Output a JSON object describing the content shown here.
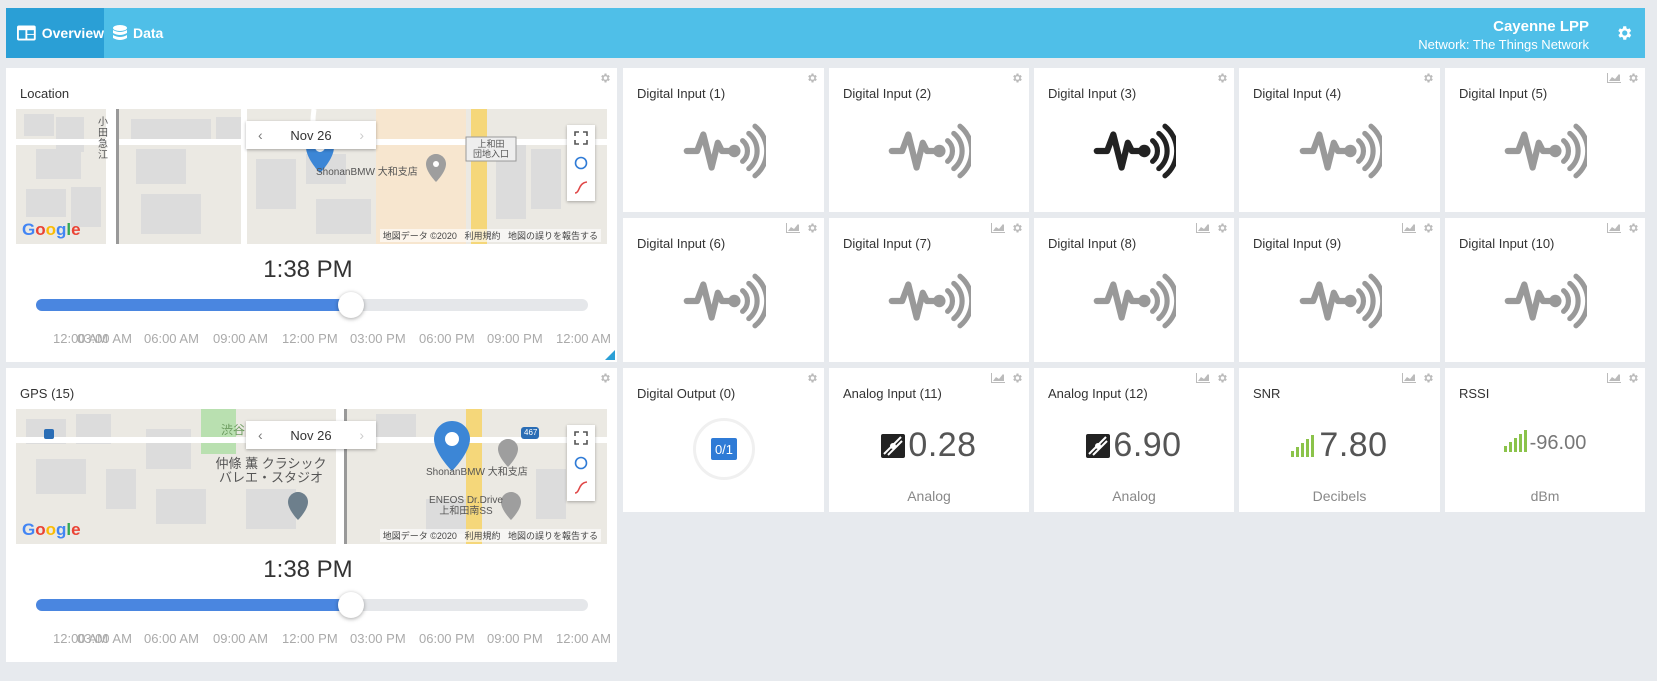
{
  "nav": {
    "tabs": [
      {
        "label": "Overview",
        "icon": "dashboard-icon",
        "active": true
      },
      {
        "label": "Data",
        "icon": "database-icon",
        "active": false
      }
    ],
    "brand_title": "Cayenne LPP",
    "brand_subtitle": "Network: The Things Network"
  },
  "maps": [
    {
      "title": "Location",
      "date": "Nov 26",
      "time": "1:38 PM",
      "slider_fraction": 0.57,
      "labels": [
        "地図データ ©2020",
        "利用規約",
        "地図の誤りを報告する"
      ],
      "places": [
        "ShonanBMW 大和支店",
        "上和田\n団地入口",
        "小田急江"
      ],
      "ticks": [
        "12:00 AM",
        "03:00 AM",
        "06:00 AM",
        "09:00 AM",
        "12:00 PM",
        "03:00 PM",
        "06:00 PM",
        "09:00 PM",
        "12:00 AM"
      ]
    },
    {
      "title": "GPS (15)",
      "date": "Nov 26",
      "time": "1:38 PM",
      "slider_fraction": 0.57,
      "labels": [
        "地図データ ©2020",
        "利用規約",
        "地図の誤りを報告する"
      ],
      "places": [
        "ShonanBMW 大和支店",
        "仲條 薫 クラシック\nバレエ・スタジオ",
        "ENEOS Dr.Drive\n上和田南SS",
        "渋谷",
        "467"
      ],
      "ticks": [
        "12:00 AM",
        "03:00 AM",
        "06:00 AM",
        "09:00 AM",
        "12:00 PM",
        "03:00 PM",
        "06:00 PM",
        "09:00 PM",
        "12:00 AM"
      ]
    }
  ],
  "digital_inputs": [
    {
      "title": "Digital Input (1)",
      "active": false
    },
    {
      "title": "Digital Input (2)",
      "active": false
    },
    {
      "title": "Digital Input (3)",
      "active": true
    },
    {
      "title": "Digital Input (4)",
      "active": false
    },
    {
      "title": "Digital Input (5)",
      "active": false
    },
    {
      "title": "Digital Input (6)",
      "active": false
    },
    {
      "title": "Digital Input (7)",
      "active": false
    },
    {
      "title": "Digital Input (8)",
      "active": false
    },
    {
      "title": "Digital Input (9)",
      "active": false
    },
    {
      "title": "Digital Input (10)",
      "active": false
    }
  ],
  "digital_output": {
    "title": "Digital Output (0)",
    "value": "0/1"
  },
  "analog": [
    {
      "title": "Analog Input (11)",
      "value": "0.28",
      "unit": "Analog"
    },
    {
      "title": "Analog Input (12)",
      "value": "6.90",
      "unit": "Analog"
    }
  ],
  "snr": {
    "title": "SNR",
    "value": "7.80",
    "unit": "Decibels"
  },
  "rssi": {
    "title": "RSSI",
    "value": "-96.00",
    "unit": "dBm"
  },
  "colors": {
    "topbar": "#4fbfe8",
    "active_tab": "#2a9fd6",
    "accent_blue": "#4a86e0",
    "signal_green": "#8bc34a"
  }
}
